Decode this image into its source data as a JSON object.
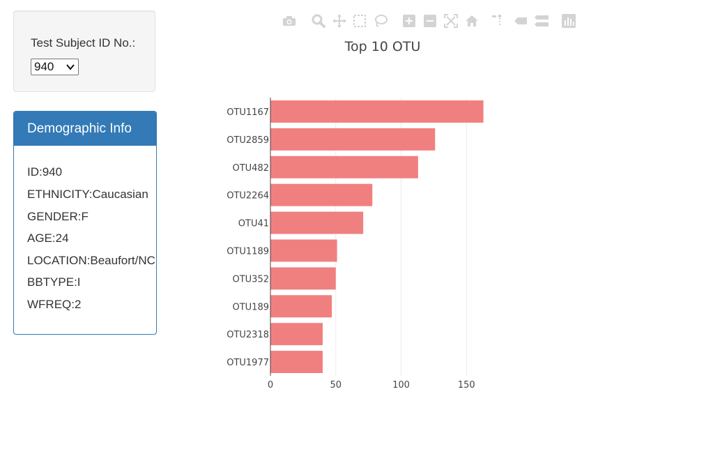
{
  "selector": {
    "label": "Test Subject ID No.:",
    "selected": "940"
  },
  "demographics": {
    "heading": "Demographic Info",
    "lines": [
      "ID:940",
      "ETHNICITY:Caucasian",
      "GENDER:F",
      "AGE:24",
      "LOCATION:Beaufort/NC",
      "BBTYPE:I",
      "WFREQ:2"
    ]
  },
  "modebar": {
    "icons": [
      "camera-icon",
      "zoom-icon",
      "pan-icon",
      "box-select-icon",
      "lasso-select-icon",
      "zoom-in-icon",
      "zoom-out-icon",
      "autoscale-icon",
      "reset-axes-icon",
      "spike-lines-icon",
      "hover-closest-icon",
      "hover-compare-icon",
      "plotly-logo-icon"
    ]
  },
  "colors": {
    "bar": "#f08080",
    "accent": "#337ab7",
    "modebar_icon": "#d3d3d3",
    "grid": "#ebebeb"
  },
  "chart_data": {
    "type": "bar",
    "orientation": "horizontal",
    "title": "Top 10 OTU",
    "categories": [
      "OTU1167",
      "OTU2859",
      "OTU482",
      "OTU2264",
      "OTU41",
      "OTU1189",
      "OTU352",
      "OTU189",
      "OTU2318",
      "OTU1977"
    ],
    "values": [
      163,
      126,
      113,
      78,
      71,
      51,
      50,
      47,
      40,
      40
    ],
    "xlim": [
      0,
      165
    ],
    "xticks": [
      0,
      50,
      100,
      150
    ],
    "grid": true
  }
}
